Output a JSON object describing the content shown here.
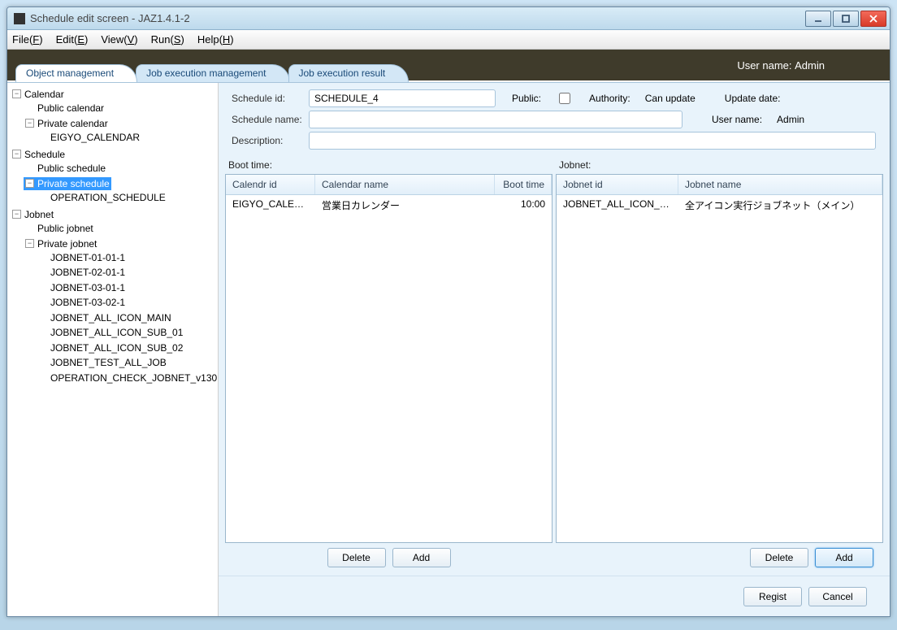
{
  "window": {
    "title": "Schedule edit screen - JAZ1.4.1-2"
  },
  "menu": {
    "file": "File(",
    "file_u": "F",
    "edit": "Edit(",
    "edit_u": "E",
    "view": "View(",
    "view_u": "V",
    "run": "Run(",
    "run_u": "S",
    "help": "Help(",
    "help_u": "H",
    "close": ")"
  },
  "banner": {
    "username_label": "User name:",
    "username_value": "Admin"
  },
  "tabs": {
    "t1": "Object management",
    "t2": "Job execution management",
    "t3": "Job execution result"
  },
  "tree": {
    "calendar": "Calendar",
    "public_calendar": "Public calendar",
    "private_calendar": "Private calendar",
    "eigyo": "EIGYO_CALENDAR",
    "schedule": "Schedule",
    "public_schedule": "Public schedule",
    "private_schedule": "Private schedule",
    "operation_schedule": "OPERATION_SCHEDULE",
    "jobnet": "Jobnet",
    "public_jobnet": "Public jobnet",
    "private_jobnet": "Private jobnet",
    "j1": "JOBNET-01-01-1",
    "j2": "JOBNET-02-01-1",
    "j3": "JOBNET-03-01-1",
    "j4": "JOBNET-03-02-1",
    "j5": "JOBNET_ALL_ICON_MAIN",
    "j6": "JOBNET_ALL_ICON_SUB_01",
    "j7": "JOBNET_ALL_ICON_SUB_02",
    "j8": "JOBNET_TEST_ALL_JOB",
    "j9": "OPERATION_CHECK_JOBNET_v130"
  },
  "form": {
    "schedule_id_label": "Schedule id:",
    "schedule_id_value": "SCHEDULE_4",
    "public_label": "Public:",
    "authority_label": "Authority:",
    "authority_value": "Can update",
    "update_date_label": "Update date:",
    "update_date_value": "",
    "schedule_name_label": "Schedule name:",
    "schedule_name_value": "",
    "user_name_label": "User name:",
    "user_name_value": "Admin",
    "description_label": "Description:",
    "description_value": ""
  },
  "boot_section": {
    "title": "Boot time:",
    "head_a": "Calendr id",
    "head_b": "Calendar name",
    "head_c": "Boot time",
    "row": {
      "a": "EIGYO_CALENDAR",
      "b": "営業日カレンダー",
      "c": "10:00"
    }
  },
  "jobnet_section": {
    "title": "Jobnet:",
    "head_a": "Jobnet id",
    "head_b": "Jobnet name",
    "row": {
      "a": "JOBNET_ALL_ICON_MAIN",
      "b": "全アイコン実行ジョブネット（メイン）"
    }
  },
  "buttons": {
    "delete": "Delete",
    "add": "Add",
    "regist": "Regist",
    "cancel": "Cancel"
  }
}
